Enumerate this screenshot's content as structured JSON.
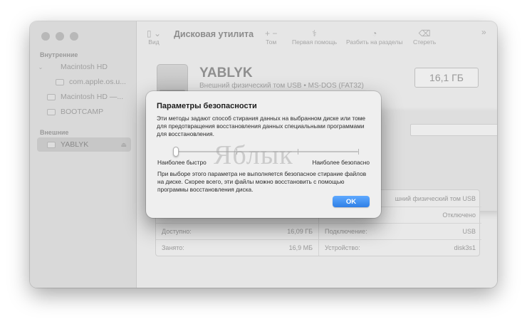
{
  "sidebar": {
    "section_internal": "Внутренние",
    "section_external": "Внешние",
    "items": [
      {
        "label": "Macintosh HD"
      },
      {
        "label": "com.apple.os.u..."
      },
      {
        "label": "Macintosh HD —..."
      },
      {
        "label": "BOOTCAMP"
      },
      {
        "label": "YABLYK"
      }
    ]
  },
  "toolbar": {
    "view_label": "Вид",
    "title": "Дисковая утилита",
    "volume_label": "Том",
    "first_aid_label": "Первая помощь",
    "partition_label": "Разбить на разделы",
    "erase_label": "Стереть"
  },
  "volume": {
    "name": "YABLYK",
    "subtitle": "Внешний физический том USB • MS-DOS (FAT32)",
    "size": "16,1 ГБ"
  },
  "info_table": {
    "right_row1_value": "шний физический том USB",
    "right_row2_value": "Отключено",
    "available_label": "Доступно:",
    "available_value": "16,09 ГБ",
    "connection_label": "Подключение:",
    "connection_value": "USB",
    "used_label": "Занято:",
    "used_value": "16,9 МБ",
    "device_label": "Устройство:",
    "device_value": "disk3s1"
  },
  "dialog": {
    "title": "Параметры безопасности",
    "description": "Эти методы задают способ стирания данных на выбранном диске или томе для предотвращения восстановления данных специальными программами для восстановления.",
    "label_fastest": "Наиболее быстро",
    "label_safest": "Наиболее безопасно",
    "slider_level": 0,
    "note": "При выборе этого параметра не выполняется безопасное стирание файлов на диске. Скорее всего, эти файлы можно восстановить с помощью программы восстановления диска.",
    "ok_label": "OK"
  },
  "watermark": "Яблык"
}
